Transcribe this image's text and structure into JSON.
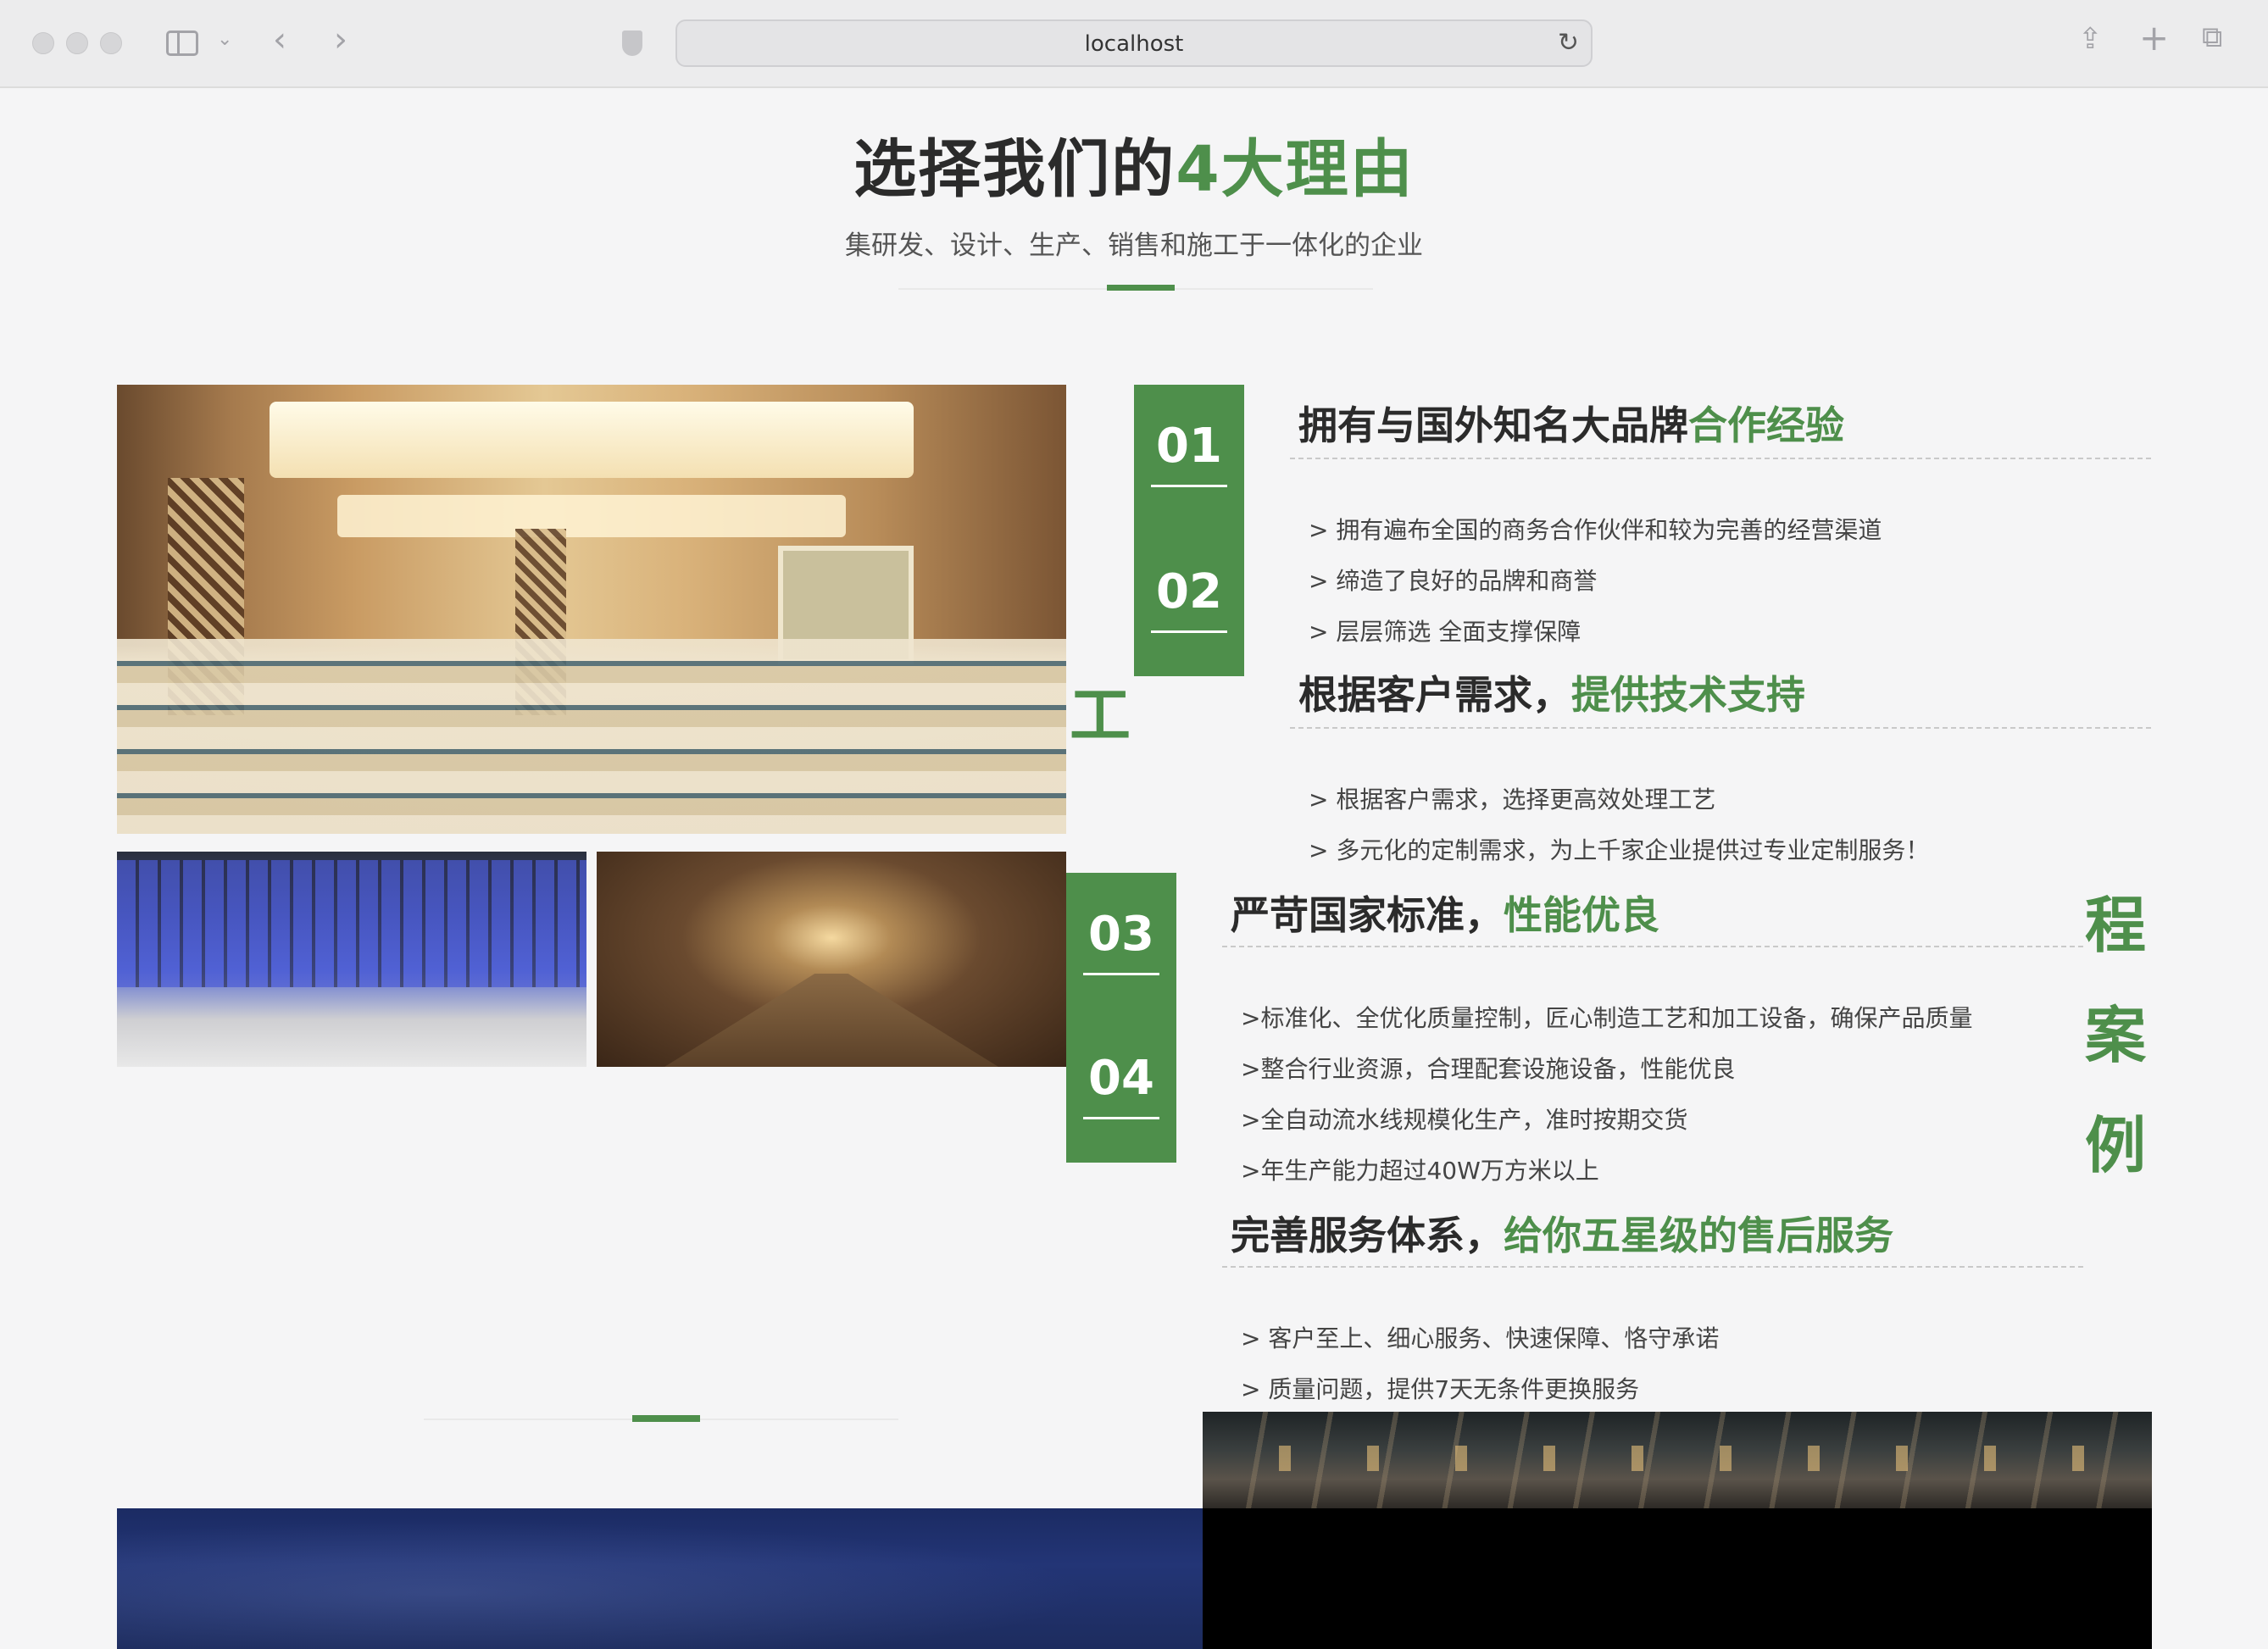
{
  "browser": {
    "url": "localhost",
    "icons": {
      "sidebar": "sidebar-icon",
      "back": "chevron-left-icon",
      "forward": "chevron-right-icon",
      "reload": "reload-icon",
      "share": "share-icon",
      "new_tab": "plus-icon",
      "tabs": "tabs-icon"
    }
  },
  "section": {
    "title_prefix": "选择我们的",
    "title_highlight": "4大理由",
    "subtitle": "集研发、设计、生产、销售和施工于一体化的企业"
  },
  "reasons": [
    {
      "number": "01",
      "heading": "拥有与国外知名大品牌",
      "heading_highlight": "合作经验",
      "items": [
        "> 拥有遍布全国的商务合作伙伴和较为完善的经营渠道",
        "> 缔造了良好的品牌和商誉",
        "> 层层筛选 全面支撑保障"
      ]
    },
    {
      "number": "02",
      "heading": "根据客户需求，",
      "heading_highlight": "提供技术支持",
      "items": [
        "> 根据客户需求，选择更高效处理工艺",
        "> 多元化的定制需求，为上千家企业提供过专业定制服务！"
      ]
    },
    {
      "number": "03",
      "heading": "严苛国家标准，",
      "heading_highlight": "性能优良",
      "items": [
        ">标准化、全优化质量控制，匠心制造工艺和加工设备，确保产品质量",
        ">整合行业资源，合理配套设施设备，性能优良",
        ">全自动流水线规模化生产，准时按期交货",
        ">年生产能力超过40W万方米以上"
      ]
    },
    {
      "number": "04",
      "heading": "完善服务体系，",
      "heading_highlight": "给你五星级的售后服务",
      "items": [
        "> 客户至上、细心服务、快速保障、恪守承诺",
        "> 质量问题，提供7天无条件更换服务"
      ]
    }
  ],
  "stray_chars": {
    "left": "工",
    "right": [
      "程",
      "案",
      "例"
    ]
  },
  "colors": {
    "accent": "#4e8f4b",
    "text": "#2b2b2b",
    "background": "#f5f5f6"
  }
}
